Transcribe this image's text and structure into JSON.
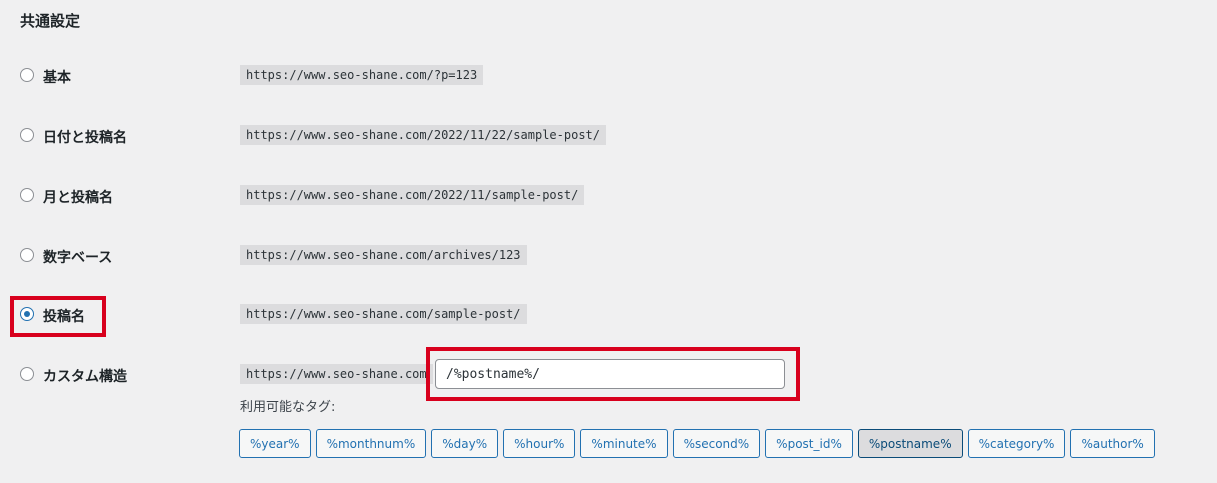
{
  "section_title": "共通設定",
  "options": [
    {
      "id": "plain",
      "label": "基本",
      "url": "https://www.seo-shane.com/?p=123",
      "checked": false
    },
    {
      "id": "day-name",
      "label": "日付と投稿名",
      "url": "https://www.seo-shane.com/2022/11/22/sample-post/",
      "checked": false
    },
    {
      "id": "month-name",
      "label": "月と投稿名",
      "url": "https://www.seo-shane.com/2022/11/sample-post/",
      "checked": false
    },
    {
      "id": "numeric",
      "label": "数字ベース",
      "url": "https://www.seo-shane.com/archives/123",
      "checked": false
    },
    {
      "id": "post-name",
      "label": "投稿名",
      "url": "https://www.seo-shane.com/sample-post/",
      "checked": true
    },
    {
      "id": "custom",
      "label": "カスタム構造",
      "url": "https://www.seo-shane.com",
      "checked": false
    }
  ],
  "custom_structure_value": "/%postname%/",
  "available_tags_label": "利用可能なタグ:",
  "tags": [
    "%year%",
    "%monthnum%",
    "%day%",
    "%hour%",
    "%minute%",
    "%second%",
    "%post_id%",
    "%postname%",
    "%category%",
    "%author%"
  ],
  "active_tag": "%postname%",
  "colors": {
    "accent": "#2271b1",
    "highlight": "#d8001d",
    "background": "#f0f0f1"
  }
}
